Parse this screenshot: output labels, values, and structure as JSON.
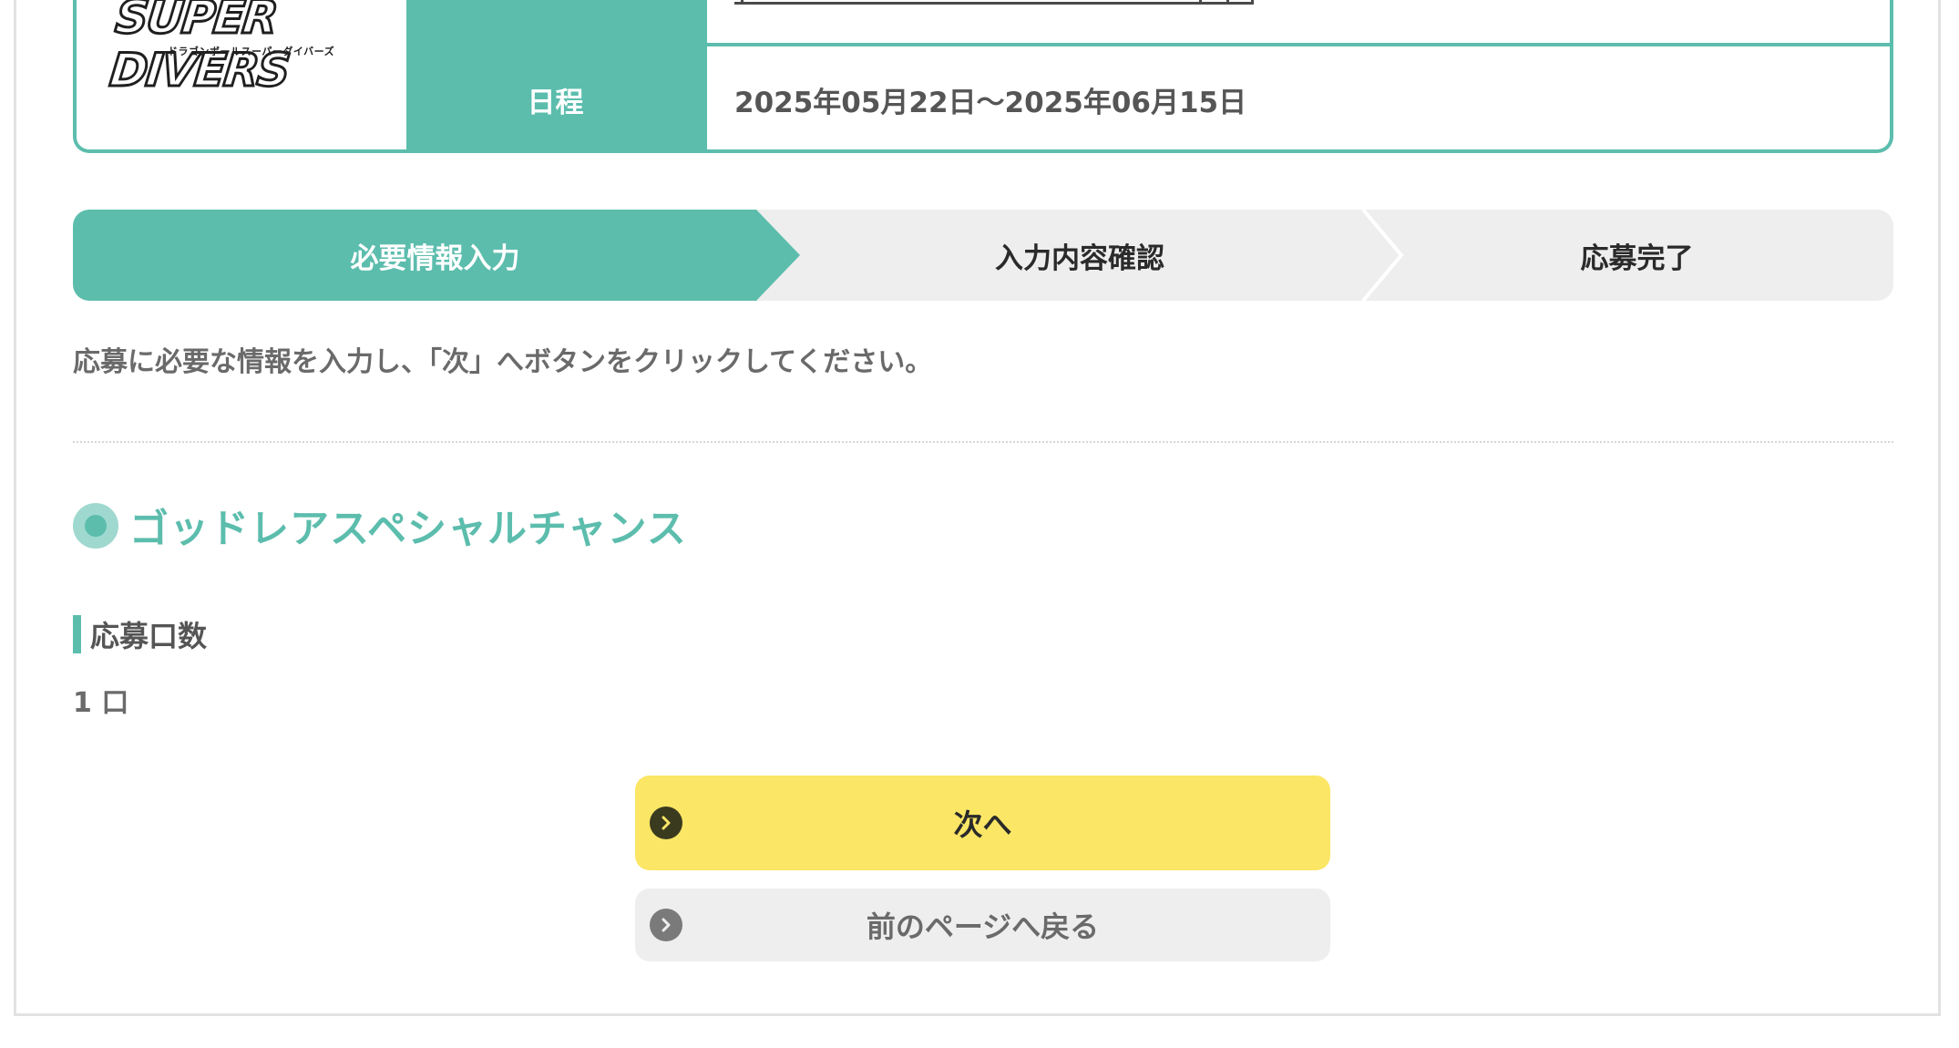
{
  "event": {
    "logo": {
      "main_text": "SUPER DIVERS",
      "sub_text": "ドラゴンボールスーパーダイバーズ"
    },
    "schedule_label": "日程",
    "schedule_value": "2025年05月22日〜2025年06月15日"
  },
  "steps": {
    "items": [
      {
        "label": "必要情報入力",
        "state": "active"
      },
      {
        "label": "入力内容確認",
        "state": "inactive"
      },
      {
        "label": "応募完了",
        "state": "inactive"
      }
    ]
  },
  "instruction": "応募に必要な情報を入力し、「次」へボタンをクリックしてください。",
  "section": {
    "title": "ゴッドレアスペシャルチャンス",
    "field_label": "応募口数",
    "field_value": "1 口"
  },
  "buttons": {
    "next_label": "次へ",
    "back_label": "前のページへ戻る"
  },
  "colors": {
    "accent": "#5cbdad",
    "next_button": "#fbe666",
    "back_button": "#eeeeee"
  }
}
